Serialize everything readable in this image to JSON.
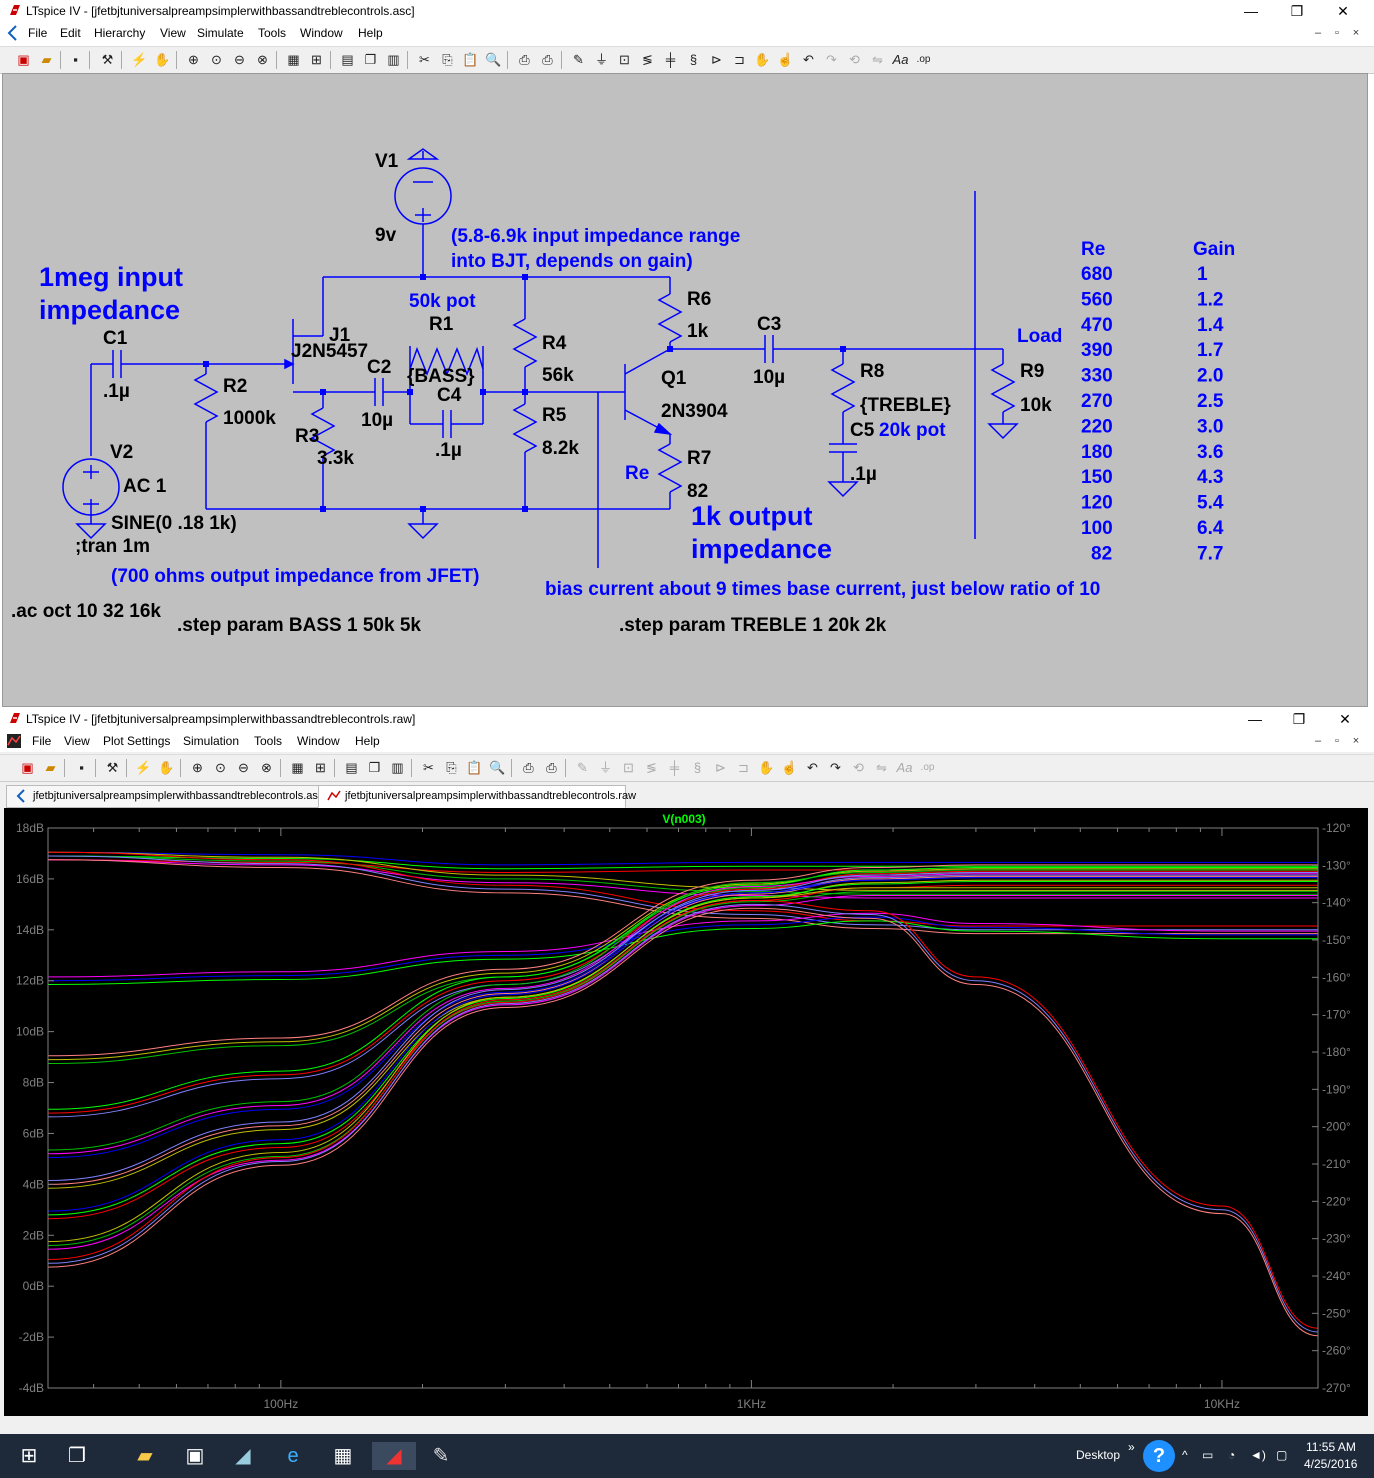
{
  "schematic_window": {
    "title": "LTspice IV - [jfetbjtuniversalpreampsimplerwithbassandtreblecontrols.asc]",
    "menu": [
      "File",
      "Edit",
      "Hierarchy",
      "View",
      "Simulate",
      "Tools",
      "Window",
      "Help"
    ],
    "controls": {
      "minimize": "—",
      "restore": "❐",
      "close": "✕"
    },
    "mdi_controls": {
      "minimize": "–",
      "restore": "▫",
      "close": "×"
    }
  },
  "schematic": {
    "components": {
      "v1": "V1",
      "v1_value": "9v",
      "v2": "V2",
      "v2_value": "AC 1",
      "v2_source": "SINE(0 .18 1k)",
      "v2_tran": ";tran 1m",
      "c1": "C1",
      "c1_value": ".1µ",
      "r2": "R2",
      "r2_value": "1000k",
      "j1": "J1",
      "j1_model": "J2N5457",
      "r3": "R3",
      "r3_value": "3.3k",
      "c2": "C2",
      "c2_value": "10µ",
      "r1": "R1",
      "r1_value": "{BASS}",
      "c4": "C4",
      "c4_value": ".1µ",
      "r4": "R4",
      "r4_value": "56k",
      "r5": "R5",
      "r5_value": "8.2k",
      "r6": "R6",
      "r6_value": "1k",
      "q1": "Q1",
      "q1_model": "2N3904",
      "r7": "R7",
      "r7_value": "82",
      "c3": "C3",
      "c3_value": "10µ",
      "r8": "R8",
      "r8_value": "{TREBLE}",
      "c5": "C5",
      "c5_value": ".1µ",
      "r9": "R9",
      "r9_value": "10k"
    },
    "annotations": {
      "input_impedance": "1meg input\nimpedance",
      "bjt_range": "(5.8-6.9k input impedance range\ninto BJT, depends on gain)",
      "bass_pot": "50k pot",
      "treble_pot": "20k pot",
      "re_label": "Re",
      "load_label": "Load",
      "output_impedance": "1k output\nimpedance",
      "jfet_output": "(700 ohms output impedance from JFET)",
      "bias_note": "bias current about 9 times base current, just below ratio of 10"
    },
    "directives": {
      "ac": ".ac oct 10 32 16k",
      "step_bass": ".step param BASS 1 50k 5k",
      "step_treble": ".step param TREBLE 1 20k 2k"
    },
    "gain_table": {
      "headers": [
        "Re",
        "Gain"
      ],
      "rows": [
        [
          "680",
          "1"
        ],
        [
          "560",
          "1.2"
        ],
        [
          "470",
          "1.4"
        ],
        [
          "390",
          "1.7"
        ],
        [
          "330",
          "2.0"
        ],
        [
          "270",
          "2.5"
        ],
        [
          "220",
          "3.0"
        ],
        [
          "180",
          "3.6"
        ],
        [
          "150",
          "4.3"
        ],
        [
          "120",
          "5.4"
        ],
        [
          "100",
          "6.4"
        ],
        [
          "82",
          "7.7"
        ]
      ]
    }
  },
  "waveform_window": {
    "title": "LTspice IV - [jfetbjtuniversalpreampsimplerwithbassandtreblecontrols.raw]",
    "menu": [
      "File",
      "View",
      "Plot Settings",
      "Simulation",
      "Tools",
      "Window",
      "Help"
    ],
    "tabs": [
      "jfetbjtuniversalpreampsimplerwithbassandtreblecontrols.asc",
      "jfetbjtuniversalpreampsimplerwithbassandtreblecontrols.raw"
    ]
  },
  "plot": {
    "trace_name": "V(n003)",
    "y_left_ticks": [
      "18dB",
      "16dB",
      "14dB",
      "12dB",
      "10dB",
      "8dB",
      "6dB",
      "4dB",
      "2dB",
      "0dB",
      "-2dB",
      "-4dB"
    ],
    "y_right_ticks": [
      "-120°",
      "-130°",
      "-140°",
      "-150°",
      "-160°",
      "-170°",
      "-180°",
      "-190°",
      "-200°",
      "-210°",
      "-220°",
      "-230°",
      "-240°",
      "-250°",
      "-260°",
      "-270°"
    ],
    "x_ticks": [
      "100Hz",
      "1KHz",
      "10KHz"
    ],
    "colors": {
      "bg": "#000000",
      "axis": "#808080",
      "trace_label": "#00ff00"
    },
    "series_colors": [
      "#ff0000",
      "#00ff00",
      "#0000ff",
      "#ff00ff",
      "#00c000",
      "#c0c000",
      "#ff8080",
      "#8080ff"
    ]
  },
  "chart_data": {
    "type": "line",
    "title": "V(n003)",
    "xscale": "log",
    "xlim": [
      32,
      16000
    ],
    "ylim": [
      -4,
      18
    ],
    "y2lim": [
      -270,
      -120
    ],
    "series": [
      {
        "x": [
          32,
          100,
          300,
          1000,
          1800,
          3000,
          10000,
          16000
        ],
        "values": [
          16.9,
          16.8,
          16.4,
          16.5,
          16.5,
          16.5,
          16.5,
          16.5
        ]
      },
      {
        "x": [
          32,
          100,
          300,
          1000,
          1800,
          3000,
          10000,
          16000
        ],
        "values": [
          16.9,
          16.7,
          16.0,
          15.5,
          15.4,
          15.4,
          15.4,
          15.4
        ]
      },
      {
        "x": [
          32,
          100,
          300,
          1000,
          1800,
          3000,
          10000,
          16000
        ],
        "values": [
          16.9,
          16.6,
          15.6,
          14.6,
          14.2,
          14.0,
          14.0,
          14.0
        ]
      },
      {
        "x": [
          32,
          100,
          300,
          1000,
          1800,
          3000,
          10000,
          16000
        ],
        "values": [
          12.0,
          12.2,
          13.0,
          14.2,
          14.5,
          14.1,
          13.8,
          13.8
        ]
      },
      {
        "x": [
          32,
          100,
          300,
          1000,
          1800,
          3000,
          10000,
          16000
        ],
        "values": [
          8.9,
          9.6,
          12.3,
          15.8,
          16.3,
          16.4,
          16.4,
          16.4
        ]
      },
      {
        "x": [
          32,
          100,
          300,
          1000,
          1800,
          3000,
          10000,
          16000
        ],
        "values": [
          6.8,
          8.3,
          12.0,
          15.6,
          16.2,
          16.3,
          16.3,
          16.3
        ]
      },
      {
        "x": [
          32,
          100,
          300,
          1000,
          1800,
          3000,
          10000,
          16000
        ],
        "values": [
          5.2,
          7.1,
          11.7,
          15.7,
          16.1,
          16.2,
          16.2,
          16.2
        ]
      },
      {
        "x": [
          32,
          100,
          300,
          1000,
          1800,
          3000,
          10000,
          16000
        ],
        "values": [
          4.0,
          6.3,
          11.5,
          15.4,
          16.0,
          16.1,
          16.1,
          16.1
        ]
      },
      {
        "x": [
          32,
          100,
          300,
          1000,
          1800,
          3000,
          10000,
          16000
        ],
        "values": [
          2.8,
          5.6,
          11.3,
          15.3,
          15.8,
          15.9,
          15.9,
          15.9
        ]
      },
      {
        "x": [
          32,
          100,
          300,
          1000,
          1800,
          3000,
          10000,
          16000
        ],
        "values": [
          1.6,
          5.1,
          11.2,
          15.1,
          15.5,
          15.5,
          15.5,
          15.5
        ]
      },
      {
        "x": [
          32,
          100,
          300,
          1000,
          1800,
          3000,
          10000,
          16000
        ],
        "values": [
          0.9,
          4.9,
          11.1,
          15.0,
          14.6,
          12.0,
          3.0,
          -1.8
        ]
      }
    ]
  },
  "taskbar": {
    "desktop_label": "Desktop",
    "time": "11:55 AM",
    "date": "4/25/2016"
  }
}
